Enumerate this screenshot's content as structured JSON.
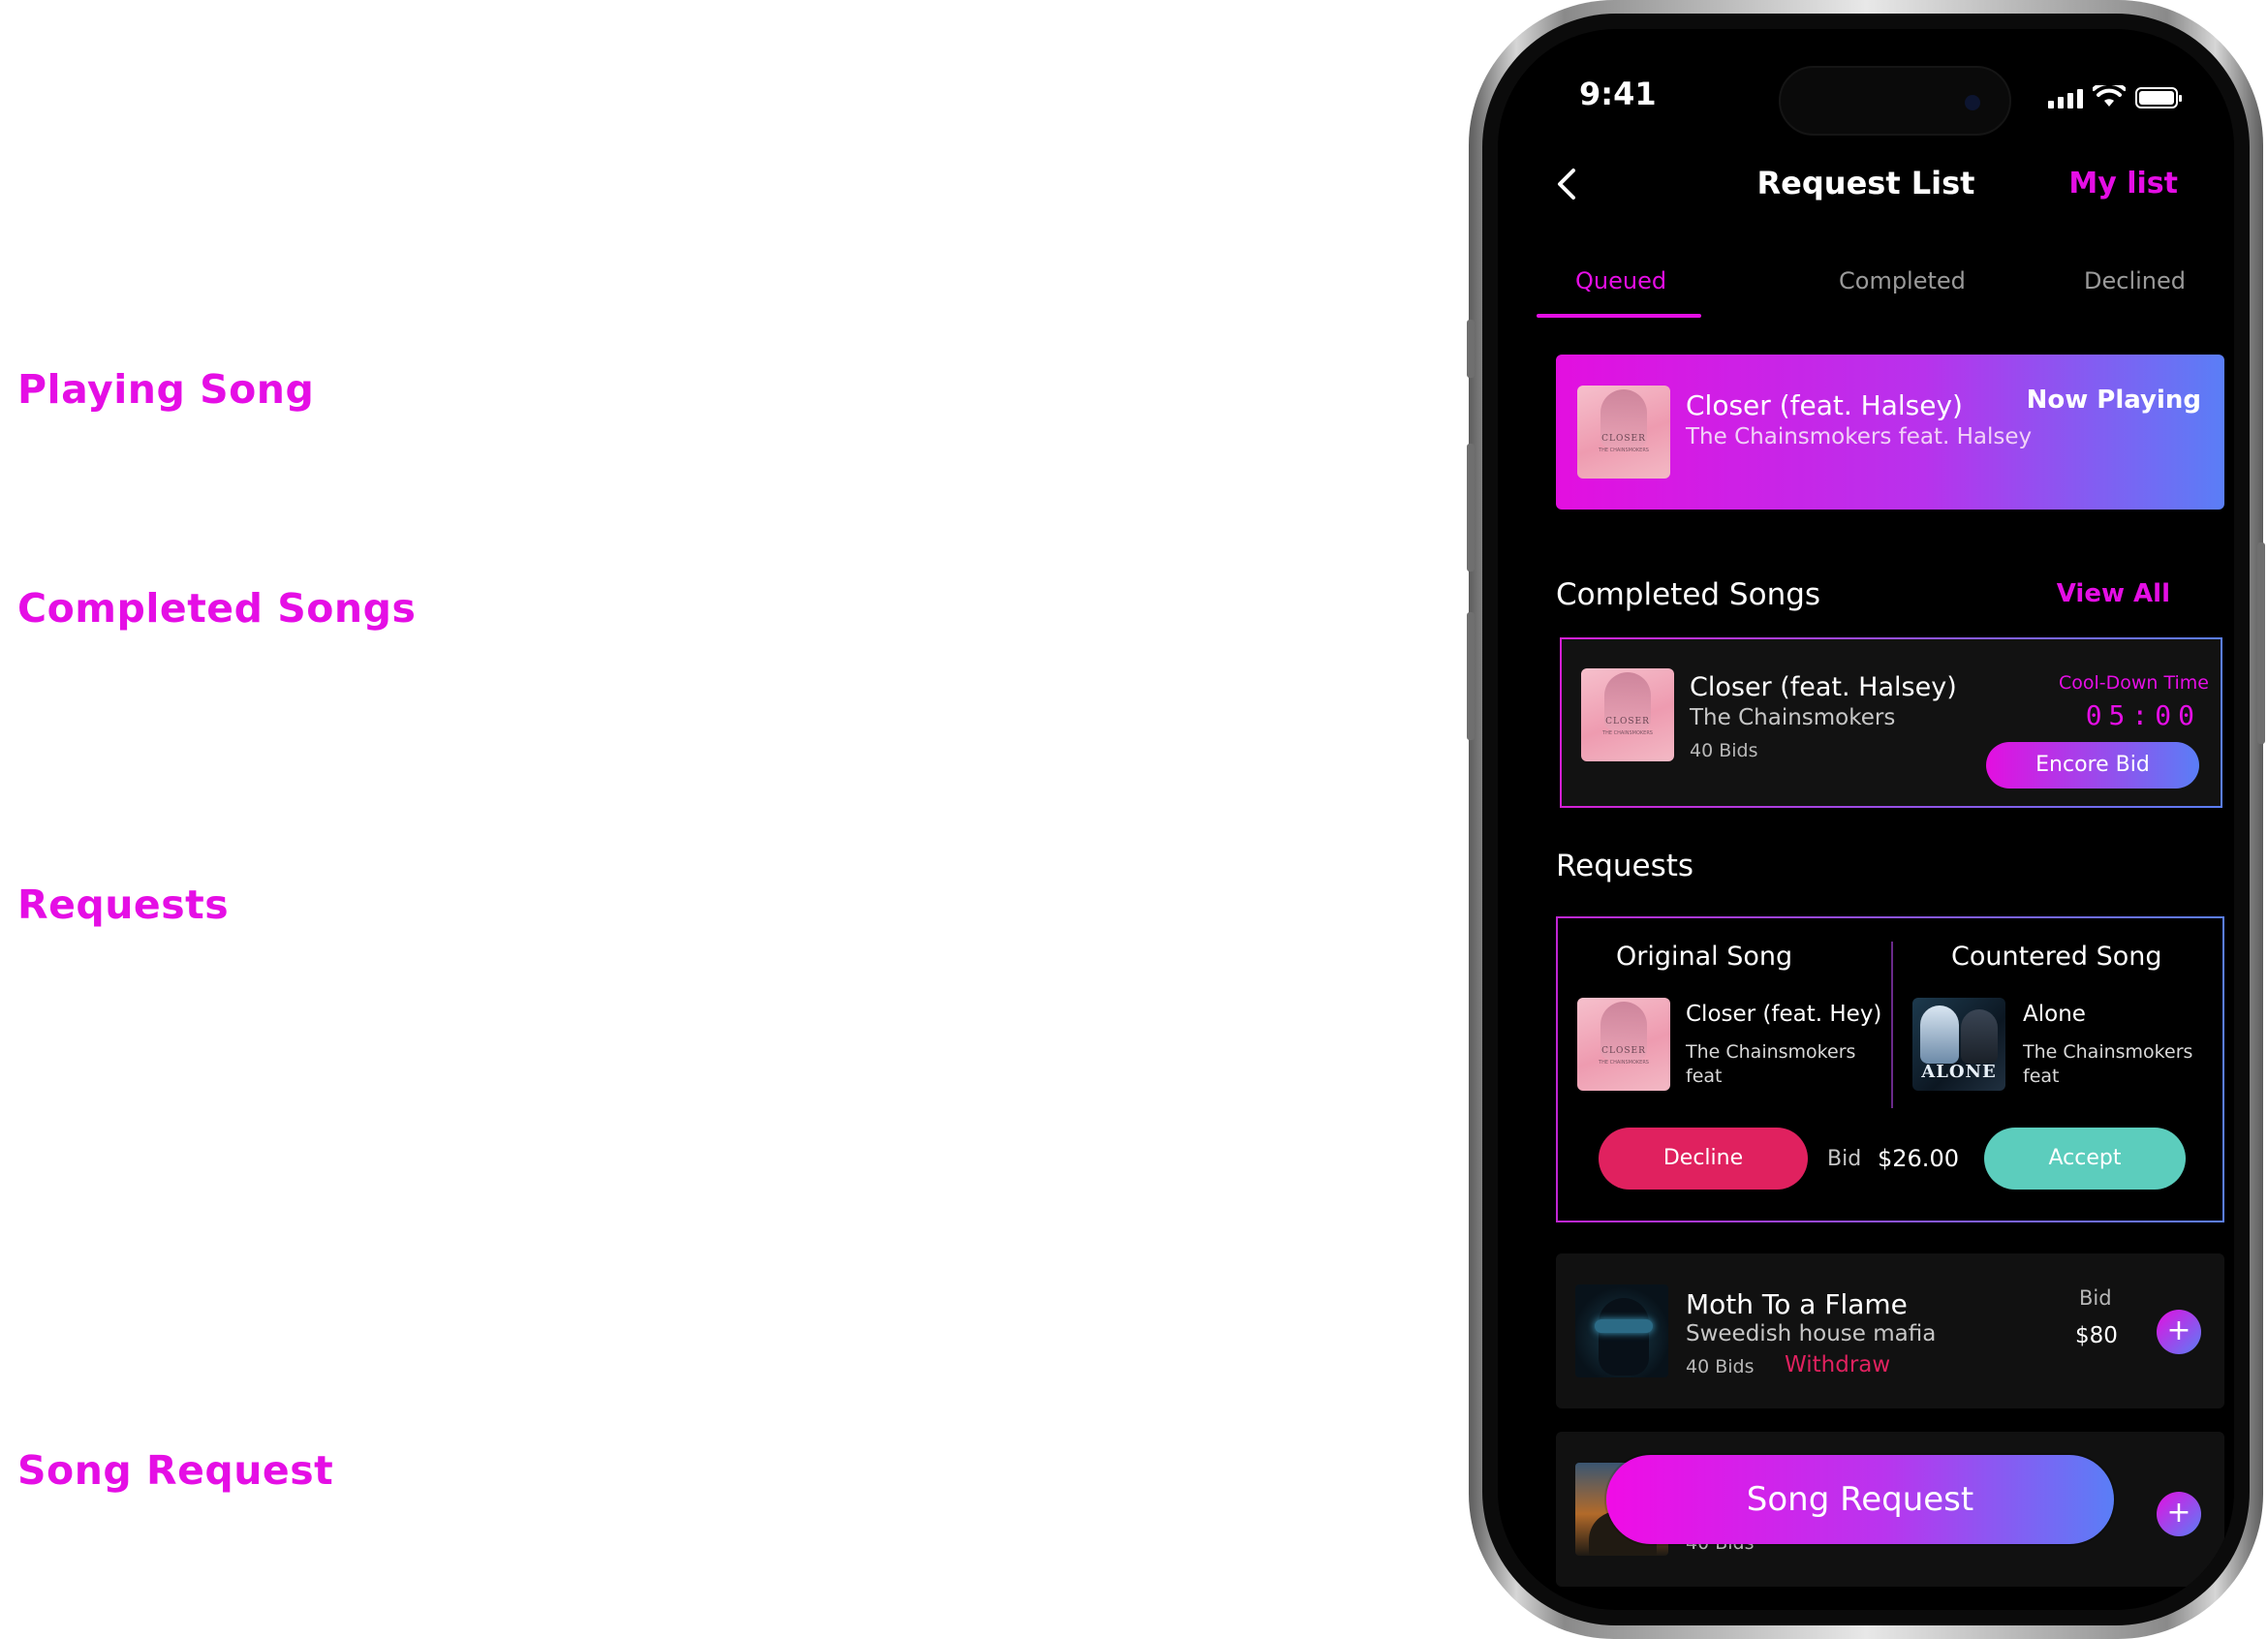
{
  "annotations": [
    "Playing Song",
    "Completed Songs",
    "Requests",
    "Song Request"
  ],
  "status_bar": {
    "time": "9:41"
  },
  "header": {
    "title": "Request List",
    "my_list": "My list"
  },
  "tabs": [
    "Queued",
    "Completed",
    "Declined"
  ],
  "now_playing": {
    "title": "Closer (feat. Halsey)",
    "artist": "The Chainsmokers feat. Halsey",
    "badge": "Now Playing",
    "cover_text": "CLOSER"
  },
  "completed": {
    "heading": "Completed Songs",
    "view_all": "View All",
    "card": {
      "title": "Closer (feat. Halsey)",
      "artist": "The Chainsmokers",
      "bids": "40 Bids",
      "cooldown_label": "Cool-Down Time",
      "cooldown_time": "05:00",
      "encore_label": "Encore Bid"
    }
  },
  "requests": {
    "heading": "Requests",
    "original": {
      "header": "Original Song",
      "title": "Closer (feat. Hey)",
      "artist": "The Chainsmokers",
      "feat": "feat"
    },
    "countered": {
      "header": "Countered Song",
      "title": "Alone",
      "artist": "The Chainsmokers",
      "feat": "feat",
      "cover_text": "ALONE"
    },
    "decline_label": "Decline",
    "bid_label": "Bid",
    "bid_value": "$26.00",
    "accept_label": "Accept"
  },
  "queue": [
    {
      "title": "Moth To a Flame",
      "artist": "Sweedish house mafia",
      "bids": "40 Bids",
      "withdraw": "Withdraw",
      "bid_label": "Bid",
      "bid_value": "$80"
    },
    {
      "bids": "40 Bids"
    }
  ],
  "song_request_label": "Song Request",
  "plus_symbol": "+",
  "colors": {
    "accent": "#e50ee5",
    "gradient_end": "#5a7ef6",
    "decline": "#e0215f",
    "accept": "#5ccdbd"
  }
}
